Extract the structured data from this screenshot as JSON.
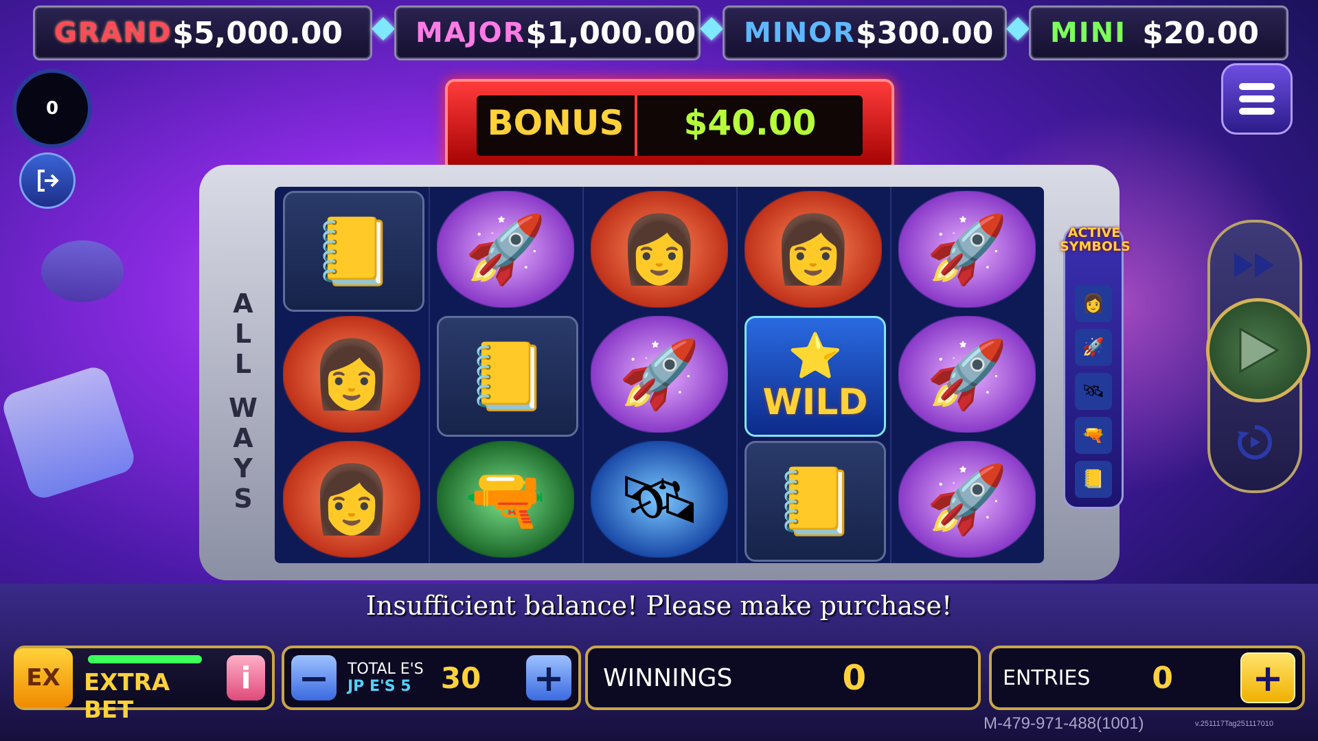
{
  "jackpots": [
    {
      "label": "GRAND",
      "amount": "$5,000.00",
      "color": "#ff4a5a"
    },
    {
      "label": "MAJOR",
      "amount": "$1,000.00",
      "color": "#ff7be6"
    },
    {
      "label": "MINOR",
      "amount": "$300.00",
      "color": "#5fb8ff"
    },
    {
      "label": "MINI",
      "amount": "$20.00",
      "color": "#7cff5a"
    }
  ],
  "counter": {
    "value": "0"
  },
  "bonus": {
    "label": "BONUS",
    "amount": "$40.00"
  },
  "reels": {
    "label_all": "ALL",
    "label_ways": "WAYS",
    "wild_text": "WILD",
    "columns": [
      [
        "card",
        "girl",
        "girl"
      ],
      [
        "rocket",
        "card",
        "raygun"
      ],
      [
        "girl",
        "rocket",
        "satellite"
      ],
      [
        "girl",
        "wild",
        "card"
      ],
      [
        "rocket",
        "rocket",
        "rocket"
      ]
    ]
  },
  "active_symbols": {
    "title_line1": "ACTIVE",
    "title_line2": "SYMBOLS"
  },
  "message": "Insufficient balance! Please make purchase!",
  "extra_bet": {
    "badge": "EX",
    "label": "EXTRA BET",
    "info": "i"
  },
  "bet": {
    "minus": "−",
    "plus": "+",
    "total_label": "TOTAL E'S",
    "jp_label": "JP E'S 5",
    "value": "30"
  },
  "winnings": {
    "label": "WINNINGS",
    "value": "0"
  },
  "entries": {
    "label": "ENTRIES",
    "value": "0",
    "plus": "+"
  },
  "footer": {
    "machine_id": "M-479-971-488(1001)",
    "version": "v.251117Tag251117010"
  },
  "colors": {
    "accent_gold": "#ffd23a",
    "bonus_green": "#b7ff3a"
  }
}
